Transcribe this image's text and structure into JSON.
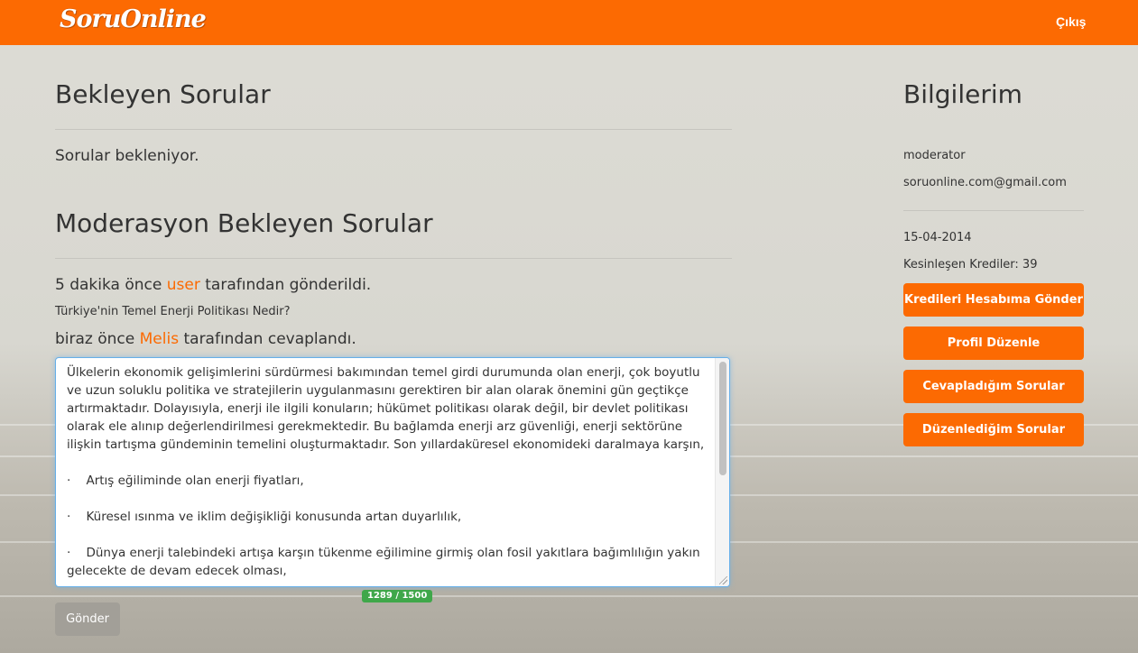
{
  "navbar": {
    "logo": "SoruOnline",
    "logout_label": "Çıkış",
    "color": "#fc6a02"
  },
  "main": {
    "pending_title": "Bekleyen Sorular",
    "pending_empty_text": "Sorular bekleniyor.",
    "moderation_title": "Moderasyon Bekleyen Sorular",
    "question": {
      "meta_prefix": "5 dakika önce",
      "meta_user": "user",
      "meta_suffix": "tarafından gönderildi.",
      "title": "Türkiye'nin Temel Enerji Politikası Nedir?"
    },
    "answer": {
      "meta_prefix": "biraz önce",
      "meta_user": "Melis",
      "meta_suffix": "tarafından cevaplandı.",
      "text": "Ülkelerin ekonomik gelişimlerini sürdürmesi bakımından temel girdi durumunda olan enerji, çok boyutlu ve uzun soluklu politika ve stratejilerin uygulanmasını gerektiren bir alan olarak önemini gün geçtikçe artırmaktadır. Dolayısıyla, enerji ile ilgili konuların; hükümet politikası olarak değil, bir devlet politikası olarak ele alınıp değerlendirilmesi gerekmektedir. Bu bağlamda enerji arz güvenliği, enerji sektörüne ilişkin tartışma gündeminin temelini oluşturmaktadır. Son yıllardaküresel ekonomideki daralmaya karşın,\n\n·    Artış eğiliminde olan enerji fiyatları,\n\n·    Küresel ısınma ve iklim değişikliği konusunda artan duyarlılık,\n\n·    Dünya enerji talebindeki artışa karşın tükenme eğilimine girmiş olan fosil yakıtlara bağımlılığın yakın gelecekte de devam edecek olması,",
      "char_counter": "1289 / 1500",
      "counter_color": "#3fa74a"
    },
    "submit_label": "Gönder"
  },
  "sidebar": {
    "title": "Bilgilerim",
    "username": "moderator",
    "email": "soruonline.com@gmail.com",
    "date": "15-04-2014",
    "credits": "Kesinleşen Krediler: 39",
    "buttons": [
      {
        "label": "Kredileri Hesabıma Gönder"
      },
      {
        "label": "Profil Düzenle"
      },
      {
        "label": "Cevapladığım Sorular"
      },
      {
        "label": "Düzenlediğim Sorular"
      }
    ]
  }
}
